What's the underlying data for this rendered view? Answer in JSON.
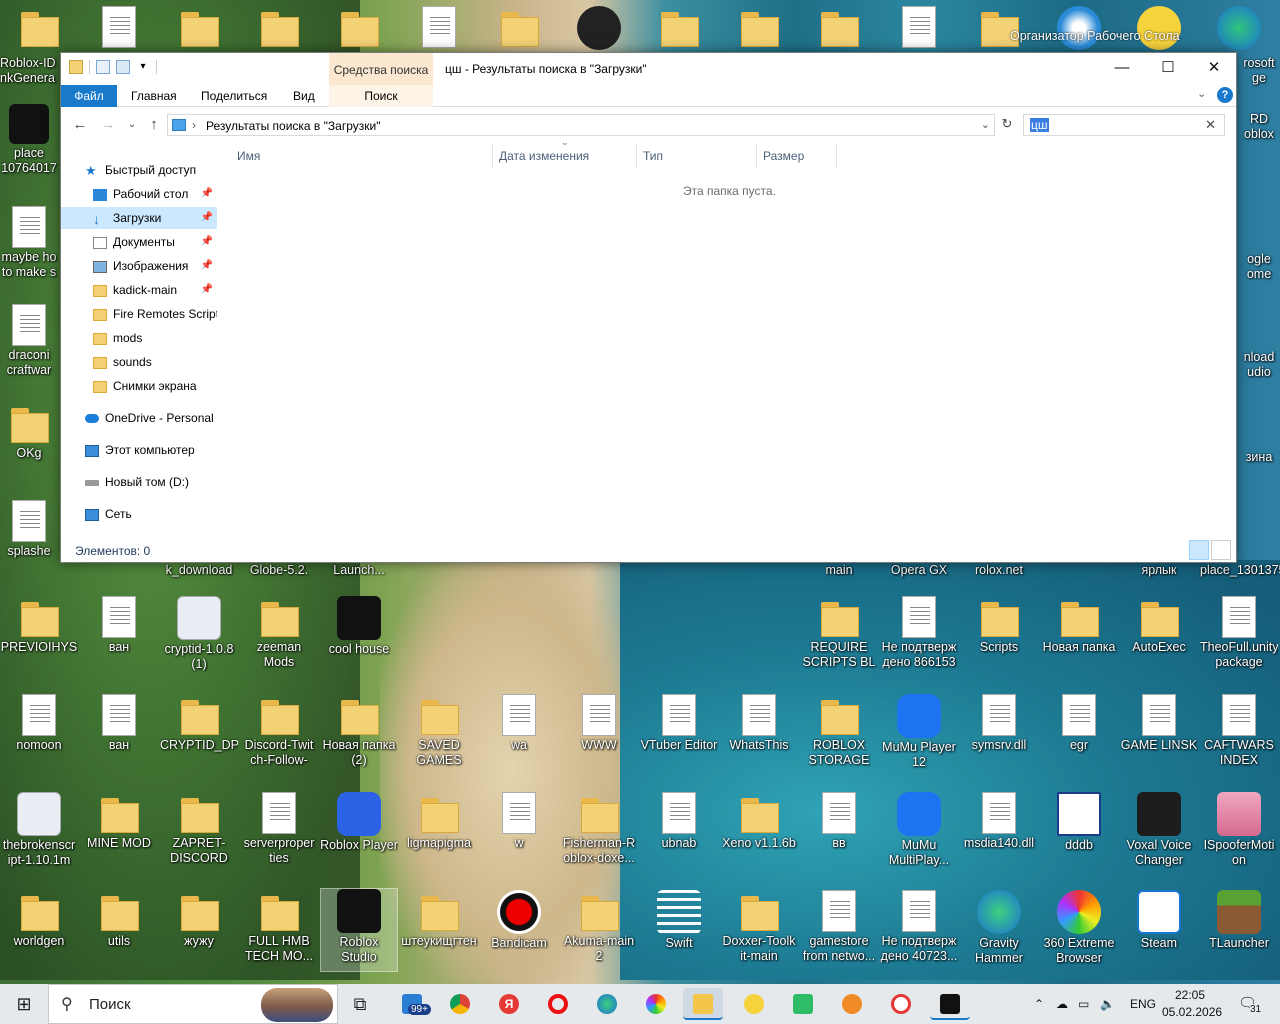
{
  "desktop": {
    "organizer_label": "Организатор Рабочего Стола",
    "icons_left_col": [
      "Roblox-ID nkGenera",
      "place 10764017",
      "maybe ho to make s",
      "draconi craftwar",
      "OKg",
      "splashe"
    ],
    "icons_under_window": [
      "k_download",
      "Globe-5.2.",
      "Launch...",
      "main",
      "Opera GX",
      "rolox.net",
      "ярлык",
      "place_130137560."
    ],
    "icons_row1": [
      "PREVIOIHYS",
      "ван",
      "cryptid-1.0.8 (1)",
      "zeeman Mods",
      "cool house",
      "REQUIRE SCRIPTS BL",
      "Не подтверж дено 866153",
      "Scripts",
      "Новая папка",
      "AutoExec",
      "TheoFull.unity package"
    ],
    "icons_row2": [
      "nomoon",
      "ван",
      "CRYPTID_DP_1.0.8",
      "Discord-Twit ch-Follow-",
      "Новая папка (2)",
      "SAVED GAMES",
      "wa",
      "WWW",
      "VTuber Editor",
      "WhatsThis",
      "ROBLOX STORAGE",
      "MuMu Player 12",
      "symsrv.dll",
      "egr",
      "GAME LINSK",
      "CAFTWARS INDEX"
    ],
    "icons_row3": [
      "thebrokenscr ipt-1.10.1m",
      "MINE MOD",
      "ZAPRET-DISCORD",
      "serverproper ties",
      "Roblox Player",
      "ligmapigma",
      "w",
      "Fisherman-R oblox-doxe...",
      "ubnab",
      "Xeno v1.1.6b",
      "вв",
      "MuMu MultiPlay...",
      "msdia140.dll",
      "dddb",
      "Voxal Voice Changer",
      "ISpooferMoti on"
    ],
    "icons_row4": [
      "worldgen",
      "utils",
      "жужу",
      "FULL HMB TECH MO...",
      "Roblox Studio",
      "штеукищгтен",
      "Bandicam",
      "Akuma-main 2",
      "Swift",
      "Doxxer-Toolk it-main",
      "gamestore from netwo...",
      "Не подтверж дено 40723...",
      "Gravity Hammer",
      "360 Extreme Browser",
      "Steam",
      "TLauncher"
    ],
    "right_col_partial": [
      "rosoft ge",
      "RD oblox",
      "ogle ome",
      "nload udio",
      "зина",
      ""
    ]
  },
  "window": {
    "title": "цш - Результаты поиска в \"Загрузки\"",
    "context_tab_group": "Средства поиска",
    "ribbon_tabs": [
      "Файл",
      "Главная",
      "Поделиться",
      "Вид",
      "Поиск"
    ],
    "address_path": "Результаты поиска в \"Загрузки\"",
    "search_query": "цш",
    "nav_items": [
      {
        "label": "Быстрый доступ",
        "pinned": false
      },
      {
        "label": "Рабочий стол",
        "pinned": true
      },
      {
        "label": "Загрузки",
        "pinned": true
      },
      {
        "label": "Документы",
        "pinned": true
      },
      {
        "label": "Изображения",
        "pinned": true
      },
      {
        "label": "kadick-main",
        "pinned": true
      },
      {
        "label": "Fire Remotes Scripts",
        "pinned": false
      },
      {
        "label": "mods",
        "pinned": false
      },
      {
        "label": "sounds",
        "pinned": false
      },
      {
        "label": "Снимки экрана",
        "pinned": false
      },
      {
        "label": "OneDrive - Personal",
        "pinned": false
      },
      {
        "label": "Этот компьютер",
        "pinned": false
      },
      {
        "label": "Новый том (D:)",
        "pinned": false
      },
      {
        "label": "Сеть",
        "pinned": false
      }
    ],
    "columns": [
      "Имя",
      "Дата изменения",
      "Тип",
      "Размер"
    ],
    "empty_message": "Эта папка пуста.",
    "status": "Элементов: 0"
  },
  "taskbar": {
    "search_placeholder": "Поиск",
    "mail_badge": "99+",
    "language": "ENG",
    "time": "22:05",
    "date": "05.02.2026",
    "notifications": "31"
  }
}
